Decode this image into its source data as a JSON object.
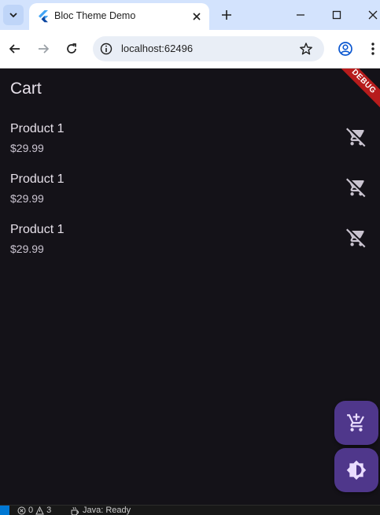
{
  "browser": {
    "tab_title": "Bloc Theme Demo",
    "url": "localhost:62496"
  },
  "app": {
    "title": "Cart",
    "debug_banner": "DEBUG",
    "cart_items": [
      {
        "name": "Product 1",
        "price": "$29.99"
      },
      {
        "name": "Product 1",
        "price": "$29.99"
      },
      {
        "name": "Product 1",
        "price": "$29.99"
      }
    ],
    "icons": {
      "remove": "remove-shopping-cart-icon",
      "fab_add": "add-shopping-cart-icon",
      "fab_theme": "brightness-icon"
    },
    "colors": {
      "background": "#141218",
      "fab": "#4f378b",
      "text": "#e6e0e9",
      "debug": "#b71c1c"
    }
  },
  "statusbar": {
    "errors": "0",
    "warnings": "3",
    "java_status": "Java: Ready"
  }
}
